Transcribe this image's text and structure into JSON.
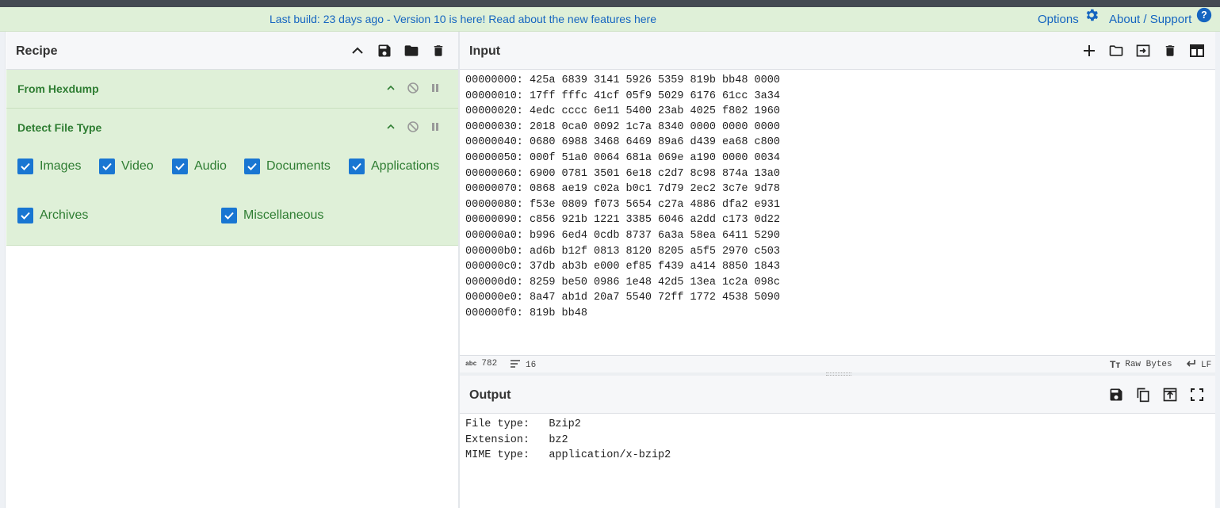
{
  "banner": {
    "notice_prefix": "Last build: 23 days ago - Version 10 is here! Read about the new features ",
    "notice_link": "here",
    "options_label": "Options",
    "about_label": "About / Support"
  },
  "recipe": {
    "title": "Recipe",
    "operations": [
      {
        "name": "From Hexdump"
      },
      {
        "name": "Detect File Type"
      }
    ],
    "detect_options": [
      {
        "label": "Images",
        "checked": true
      },
      {
        "label": "Video",
        "checked": true
      },
      {
        "label": "Audio",
        "checked": true
      },
      {
        "label": "Documents",
        "checked": true
      },
      {
        "label": "Applications",
        "checked": true
      },
      {
        "label": "Archives",
        "checked": true
      },
      {
        "label": "Miscellaneous",
        "checked": true
      }
    ]
  },
  "input": {
    "title": "Input",
    "lines": [
      "00000000: 425a 6839 3141 5926 5359 819b bb48 0000",
      "00000010: 17ff fffc 41cf 05f9 5029 6176 61cc 3a34",
      "00000020: 4edc cccc 6e11 5400 23ab 4025 f802 1960",
      "00000030: 2018 0ca0 0092 1c7a 8340 0000 0000 0000",
      "00000040: 0680 6988 3468 6469 89a6 d439 ea68 c800",
      "00000050: 000f 51a0 0064 681a 069e a190 0000 0034",
      "00000060: 6900 0781 3501 6e18 c2d7 8c98 874a 13a0",
      "00000070: 0868 ae19 c02a b0c1 7d79 2ec2 3c7e 9d78",
      "00000080: f53e 0809 f073 5654 c27a 4886 dfa2 e931",
      "00000090: c856 921b 1221 3385 6046 a2dd c173 0d22",
      "000000a0: b996 6ed4 0cdb 8737 6a3a 58ea 6411 5290",
      "000000b0: ad6b b12f 0813 8120 8205 a5f5 2970 c503",
      "000000c0: 37db ab3b e000 ef85 f439 a414 8850 1843",
      "000000d0: 8259 be50 0986 1e48 42d5 13ea 1c2a 098c",
      "000000e0: 8a47 ab1d 20a7 5540 72ff 1772 4538 5090",
      "000000f0: 819b bb48"
    ],
    "status": {
      "char_icon": "abc",
      "char_count": "782",
      "line_count": "16",
      "encoding_icon": "Tт",
      "encoding": "Raw Bytes",
      "eol": "LF"
    }
  },
  "output": {
    "title": "Output",
    "lines": [
      "File type:   Bzip2",
      "Extension:   bz2",
      "MIME type:   application/x-bzip2"
    ]
  },
  "colors": {
    "accent": "#1976d2",
    "op_bg": "#dff0d8",
    "op_text": "#2e7d32",
    "link": "#1565c0"
  }
}
